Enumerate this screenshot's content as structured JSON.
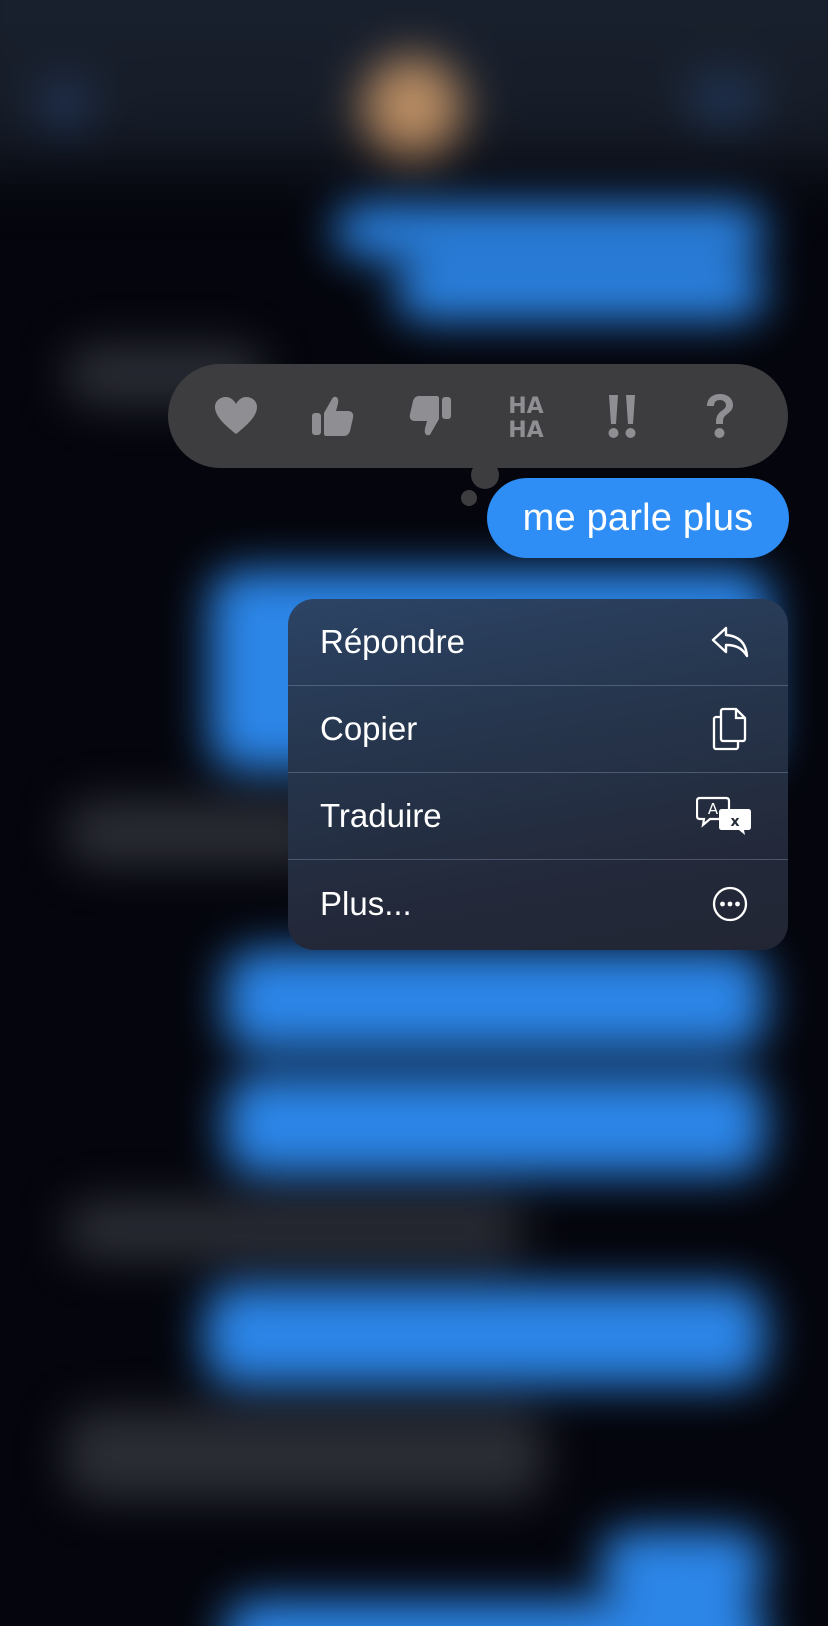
{
  "message": {
    "text": "me parle plus"
  },
  "reactions": [
    {
      "name": "heart",
      "glyph": "♥"
    },
    {
      "name": "thumbs-up",
      "glyph": "👍"
    },
    {
      "name": "thumbs-down",
      "glyph": "👎"
    },
    {
      "name": "haha",
      "line1": "HA",
      "line2": "HA"
    },
    {
      "name": "exclamation",
      "glyph": "!!"
    },
    {
      "name": "question",
      "glyph": "?"
    }
  ],
  "menu": {
    "items": [
      {
        "label": "Répondre",
        "icon": "reply-icon"
      },
      {
        "label": "Copier",
        "icon": "copy-icon"
      },
      {
        "label": "Traduire",
        "icon": "translate-icon"
      },
      {
        "label": "Plus...",
        "icon": "more-icon"
      }
    ]
  },
  "colors": {
    "accent_blue": "#2f8ef5",
    "tapback_bg": "#3d3d40",
    "reaction_grey": "#8e8e93",
    "background": "#05060d"
  }
}
